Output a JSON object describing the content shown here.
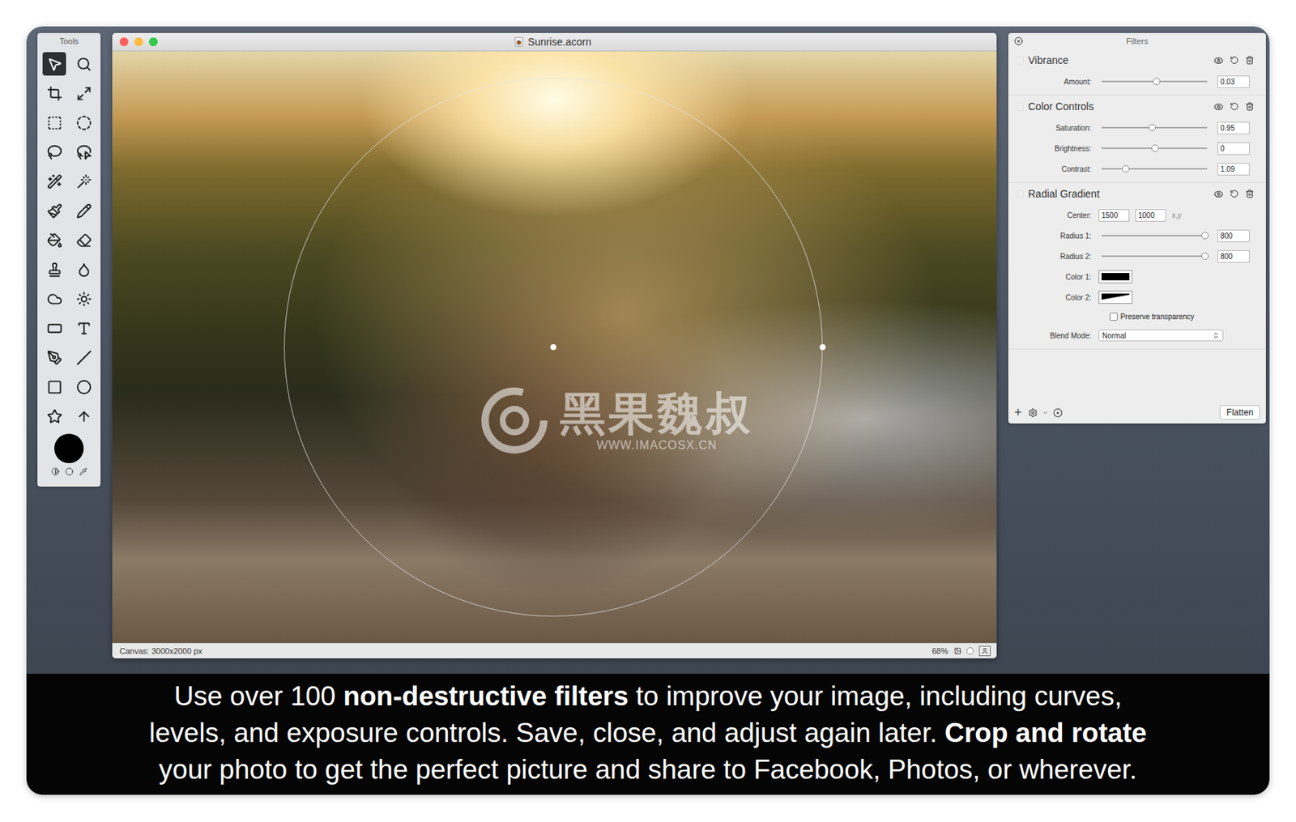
{
  "window": {
    "title": "Sunrise.acorn",
    "canvas_label": "Canvas: 3000x2000 px",
    "zoom": "68%",
    "zoom_level": 0.05
  },
  "tools": {
    "title": "Tools",
    "foreground_color": "#000000",
    "items": [
      {
        "selected": true
      },
      {
        "selected": false
      },
      {
        "selected": false
      },
      {
        "selected": false
      },
      {
        "selected": false
      },
      {
        "selected": false
      },
      {
        "selected": false
      },
      {
        "selected": false
      },
      {
        "selected": false
      },
      {
        "selected": false
      },
      {
        "selected": false
      },
      {
        "selected": false
      },
      {
        "selected": false
      },
      {
        "selected": false
      },
      {
        "selected": false
      },
      {
        "selected": false
      },
      {
        "selected": false
      },
      {
        "selected": false
      },
      {
        "selected": false
      },
      {
        "selected": false
      },
      {
        "selected": false
      },
      {
        "selected": false
      },
      {
        "selected": false
      },
      {
        "selected": false
      },
      {
        "selected": false
      },
      {
        "selected": false
      }
    ]
  },
  "watermark": {
    "brand": "黑果魏叔",
    "url": "WWW.IMACOSX.CN"
  },
  "filters": {
    "title": "Filters",
    "groups": [
      {
        "title": "Vibrance",
        "checked": false,
        "rows": [
          {
            "kind": "slider",
            "label": "Amount:",
            "level": 0.52,
            "value": "0.03"
          }
        ]
      },
      {
        "title": "Color Controls",
        "checked": false,
        "rows": [
          {
            "kind": "slider",
            "label": "Saturation:",
            "level": 0.48,
            "value": "0.95"
          },
          {
            "kind": "slider",
            "label": "Brightness:",
            "level": 0.51,
            "value": "0"
          },
          {
            "kind": "slider",
            "label": "Contrast:",
            "level": 0.23,
            "value": "1.09"
          }
        ]
      },
      {
        "title": "Radial Gradient",
        "checked": false,
        "rows": [
          {
            "kind": "point",
            "label": "Center:",
            "x": "1500",
            "y": "1000",
            "unit": "x,y"
          },
          {
            "kind": "slider",
            "label": "Radius 1:",
            "level": 0.98,
            "value": "800"
          },
          {
            "kind": "slider",
            "label": "Radius 2:",
            "level": 0.98,
            "value": "800"
          },
          {
            "kind": "color",
            "label": "Color 1:",
            "color": "#000000",
            "fade": false
          },
          {
            "kind": "color",
            "label": "Color 2:",
            "color": "#000000",
            "fade": true
          },
          {
            "kind": "checkbox",
            "label": "Preserve transparency",
            "checked": false
          },
          {
            "kind": "select",
            "label": "Blend Mode:",
            "value": "Normal"
          }
        ]
      }
    ],
    "footer": {
      "add": "+",
      "button": "Flatten"
    }
  },
  "caption": {
    "lines": [
      [
        {
          "text": "Use over 100 ",
          "bold": false
        },
        {
          "text": "non-destructive filters",
          "bold": true
        },
        {
          "text": " to improve your image, including curves,",
          "bold": false
        }
      ],
      [
        {
          "text": "levels, and exposure controls. Save, close, and adjust again later. ",
          "bold": false
        },
        {
          "text": "Crop and rotate",
          "bold": true
        }
      ],
      [
        {
          "text": "your photo to get the perfect picture and share to Facebook, Photos, or wherever.",
          "bold": false
        }
      ]
    ]
  }
}
